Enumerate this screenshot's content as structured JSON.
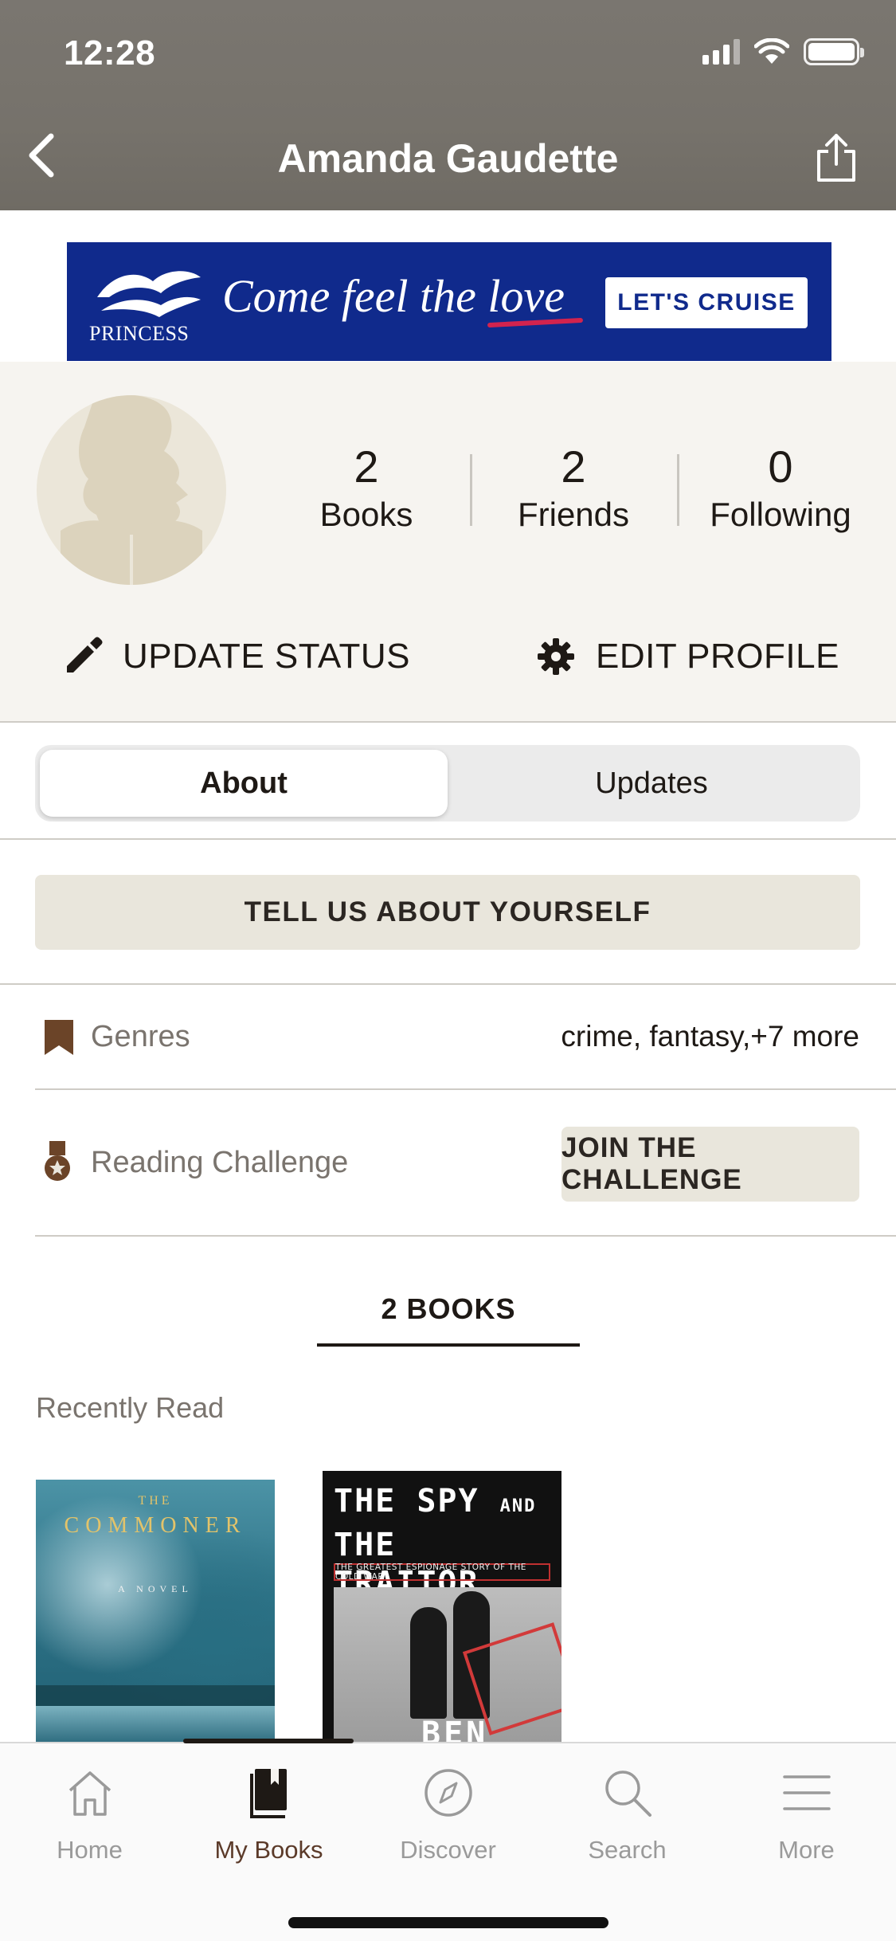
{
  "status_bar": {
    "time": "12:28"
  },
  "header": {
    "title": "Amanda Gaudette"
  },
  "ad": {
    "brand": "PRINCESS",
    "tagline": "Come feel the love",
    "cta": "LET'S CRUISE"
  },
  "profile": {
    "stats": [
      {
        "value": "2",
        "label": "Books"
      },
      {
        "value": "2",
        "label": "Friends"
      },
      {
        "value": "0",
        "label": "Following"
      }
    ],
    "update_status": "UPDATE STATUS",
    "edit_profile": "EDIT PROFILE"
  },
  "segments": {
    "about": "About",
    "updates": "Updates",
    "selected": "About"
  },
  "tell_us": "TELL US ABOUT YOURSELF",
  "genres": {
    "label": "Genres",
    "value": "crime, fantasy,+7 more"
  },
  "challenge": {
    "label": "Reading Challenge",
    "button": "JOIN THE CHALLENGE"
  },
  "books_tab": "2 BOOKS",
  "recently_read": "Recently Read",
  "books": [
    {
      "the": "THE",
      "title": "COMMONER",
      "subtitle": "A NOVEL"
    },
    {
      "title_line1": "THE SPY",
      "title_and": "AND",
      "title_line2": "THE TRAITOR",
      "subtitle": "THE GREATEST ESPIONAGE STORY OF THE COLD WAR",
      "author": "BEN"
    }
  ],
  "tabbar": {
    "items": [
      {
        "label": "Home",
        "icon": "house-icon"
      },
      {
        "label": "My Books",
        "icon": "book-icon",
        "active": true
      },
      {
        "label": "Discover",
        "icon": "compass-icon"
      },
      {
        "label": "Search",
        "icon": "magnifier-icon"
      },
      {
        "label": "More",
        "icon": "hamburger-icon"
      }
    ]
  },
  "colors": {
    "accent_brown": "#5b3a29",
    "header_gray": "#76726b",
    "button_beige": "#e9e6dc",
    "ad_blue": "#102a8c"
  }
}
